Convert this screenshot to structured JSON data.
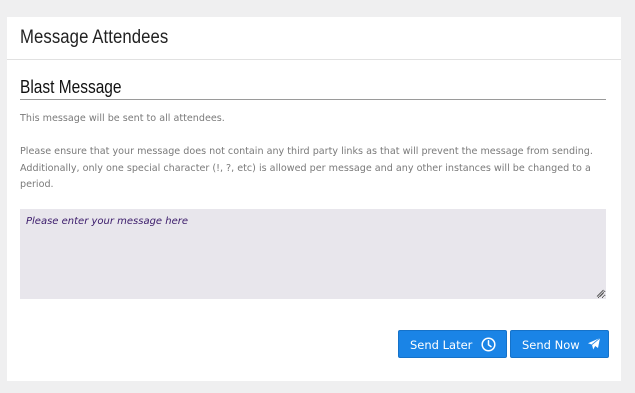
{
  "panel": {
    "title": "Message Attendees"
  },
  "blast": {
    "heading": "Blast Message",
    "info_line1": "This message will be sent to all attendees.",
    "info_line2": "Please ensure that your message does not contain any third party links as that will prevent the message from sending. Additionally, only one special character (!, ?, etc) is allowed per message and any other instances will be changed to a period.",
    "message_value": "",
    "message_placeholder": "Please enter your message here"
  },
  "actions": {
    "send_later_label": "Send Later",
    "send_later_icon": "clock-icon",
    "send_now_label": "Send Now",
    "send_now_icon": "paper-plane-icon"
  },
  "colors": {
    "button": "#1a84e6",
    "textarea_bg": "#e8e6ec",
    "page_bg": "#efeff0"
  }
}
